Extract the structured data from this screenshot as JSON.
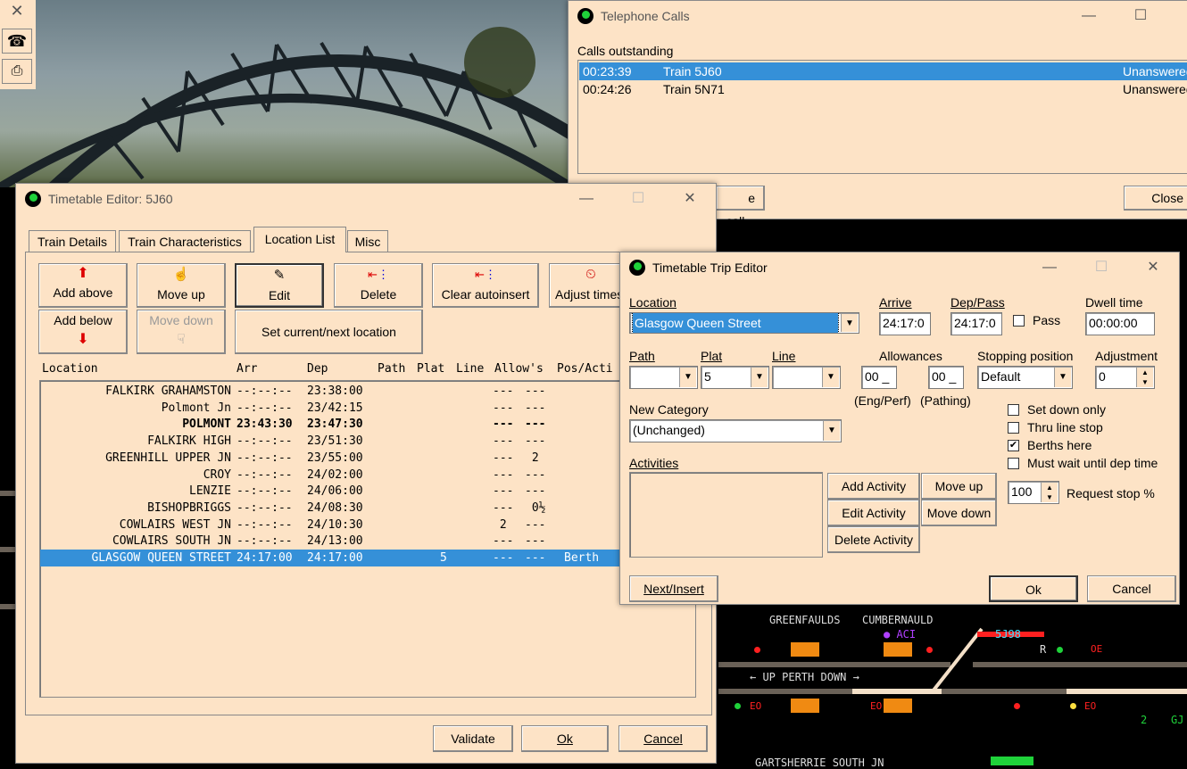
{
  "colors": {
    "window_bg": "#fde3c6",
    "selection": "#3590d8",
    "signal_green": "#1fd23a",
    "track": "#6a6157",
    "orange_block": "#f08a12"
  },
  "launcher": {
    "close_icon": "close-icon",
    "phone_icon": "telephone-icon",
    "printer_icon": "printer-icon"
  },
  "phone_window": {
    "title": "Telephone Calls",
    "calls_label": "Calls outstanding",
    "calls": [
      {
        "time": "00:23:39",
        "train": "Train 5J60",
        "status": "Unanswered"
      },
      {
        "time": "00:24:26",
        "train": "Train 5N71",
        "status": "Unanswered"
      }
    ],
    "place_call_label": "e call...",
    "close_label": "Close"
  },
  "timetable_editor": {
    "title": "Timetable Editor: 5J60",
    "tabs": [
      "Train Details",
      "Train Characteristics",
      "Location List",
      "Misc"
    ],
    "active_tab": "Location List",
    "buttons": {
      "add_above": "Add above",
      "add_below": "Add below",
      "move_up": "Move up",
      "move_down": "Move down",
      "edit": "Edit",
      "delete": "Delete",
      "clear_autoinsert": "Clear autoinsert",
      "adjust_times": "Adjust times",
      "set_current": "Set current/next location"
    },
    "columns": {
      "location": "Location",
      "arr": "Arr",
      "dep": "Dep",
      "path": "Path",
      "plat": "Plat",
      "line": "Line",
      "allows": "Allow's",
      "pos": "Pos/Acti"
    },
    "rows": [
      {
        "location": "FALKIRK GRAHAMSTON",
        "arr": "--:--:--",
        "dep": "23:38:00",
        "path": "",
        "plat": "",
        "line": "",
        "allow1": "---",
        "allow2": "---",
        "pos": ""
      },
      {
        "location": "Polmont Jn",
        "arr": "--:--:--",
        "dep": "23/42:15",
        "path": "",
        "plat": "",
        "line": "",
        "allow1": "---",
        "allow2": "---",
        "pos": ""
      },
      {
        "location": "POLMONT",
        "arr": "23:43:30",
        "dep": "23:47:30",
        "path": "",
        "plat": "",
        "line": "",
        "allow1": "---",
        "allow2": "---",
        "pos": ""
      },
      {
        "location": "FALKIRK HIGH",
        "arr": "--:--:--",
        "dep": "23/51:30",
        "path": "",
        "plat": "",
        "line": "",
        "allow1": "---",
        "allow2": "---",
        "pos": ""
      },
      {
        "location": "GREENHILL UPPER JN",
        "arr": "--:--:--",
        "dep": "23/55:00",
        "path": "",
        "plat": "",
        "line": "",
        "allow1": "---",
        "allow2": " 2",
        "pos": ""
      },
      {
        "location": "CROY",
        "arr": "--:--:--",
        "dep": "24/02:00",
        "path": "",
        "plat": "",
        "line": "",
        "allow1": "---",
        "allow2": "---",
        "pos": ""
      },
      {
        "location": "LENZIE",
        "arr": "--:--:--",
        "dep": "24/06:00",
        "path": "",
        "plat": "",
        "line": "",
        "allow1": "---",
        "allow2": "---",
        "pos": ""
      },
      {
        "location": "BISHOPBRIGGS",
        "arr": "--:--:--",
        "dep": "24/08:30",
        "path": "",
        "plat": "",
        "line": "",
        "allow1": "---",
        "allow2": " 0½",
        "pos": ""
      },
      {
        "location": "COWLAIRS WEST JN",
        "arr": "--:--:--",
        "dep": "24/10:30",
        "path": "",
        "plat": "",
        "line": "",
        "allow1": " 2",
        "allow2": "---",
        "pos": ""
      },
      {
        "location": "COWLAIRS SOUTH JN",
        "arr": "--:--:--",
        "dep": "24/13:00",
        "path": "",
        "plat": "",
        "line": "",
        "allow1": "---",
        "allow2": "---",
        "pos": ""
      },
      {
        "location": "GLASGOW QUEEN STREET",
        "arr": "24:17:00",
        "dep": "24:17:00",
        "path": "",
        "plat": "5",
        "line": "",
        "allow1": "---",
        "allow2": "---",
        "pos": "Berth"
      }
    ],
    "footer": {
      "validate": "Validate",
      "ok": "Ok",
      "cancel": "Cancel"
    }
  },
  "trip_editor": {
    "title": "Timetable Trip Editor",
    "location_label": "Location",
    "location_value": "Glasgow Queen Street",
    "arrive_label": "Arrive",
    "arrive_value": "24:17:0",
    "deppass_label": "Dep/Pass",
    "deppass_value": "24:17:0",
    "pass_label": "Pass",
    "dwell_label": "Dwell time",
    "dwell_value": "00:00:00",
    "path_label": "Path",
    "path_value": "",
    "plat_label": "Plat",
    "plat_value": "5",
    "line_label": "Line",
    "line_value": "",
    "allowances_label": "Allowances",
    "eng_value": "00 _",
    "pathing_value": "00 _",
    "eng_label": "(Eng/Perf)",
    "pathing_label": "(Pathing)",
    "stopping_label": "Stopping position",
    "stopping_value": "Default",
    "adjustment_label": "Adjustment",
    "adjustment_value": "0",
    "category_label": "New Category",
    "category_value": "(Unchanged)",
    "setdown_label": "Set down only",
    "thru_label": "Thru line stop",
    "berths_label": "Berths here",
    "mustwait_label": "Must wait until dep time",
    "berths_checked": "✔",
    "activities_label": "Activities",
    "add_activity": "Add Activity",
    "edit_activity": "Edit Activity",
    "delete_activity": "Delete Activity",
    "move_up": "Move up",
    "move_down": "Move down",
    "request_value": "100",
    "request_label": "Request stop %",
    "next_insert": "Next/Insert",
    "ok": "Ok",
    "cancel": "Cancel"
  },
  "panel": {
    "greenfaulds": "GREENFAULDS",
    "cumbernauld": "CUMBERNAULD",
    "aci": "● ACI",
    "headcode": "5J98",
    "up_perth_down": "← UP PERTH DOWN →",
    "eo": "EO",
    "oe": "OE",
    "r": "R",
    "gartsherrie": "GARTSHERRIE SOUTH JN",
    "two": "2",
    "gj": "GJ"
  }
}
